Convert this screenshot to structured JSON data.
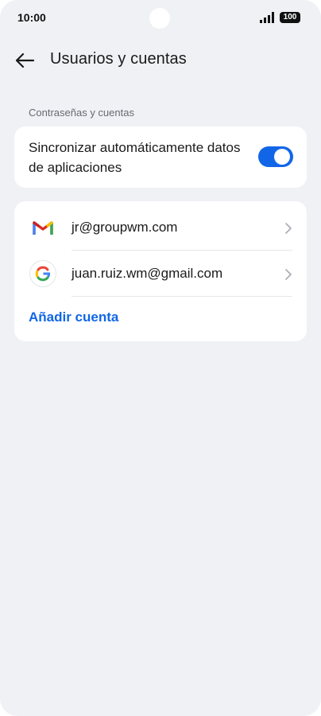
{
  "status_bar": {
    "time": "10:00",
    "battery": "100",
    "icons": [
      "signal-icon",
      "battery-icon"
    ]
  },
  "header": {
    "back_icon": "back-arrow-icon",
    "title": "Usuarios y cuentas"
  },
  "section": {
    "label": "Contraseñas y cuentas"
  },
  "sync": {
    "label": "Sincronizar automáticamente datos de aplicaciones",
    "enabled": true
  },
  "accounts": [
    {
      "icon": "gmail-icon",
      "label": "jr@groupwm.com"
    },
    {
      "icon": "google-icon",
      "label": "juan.ruiz.wm@gmail.com"
    }
  ],
  "add_account": {
    "label": "Añadir cuenta"
  },
  "colors": {
    "accent": "#1166e8",
    "background": "#f0f1f5",
    "card": "#ffffff",
    "text": "#1a1a1a",
    "secondary_text": "#666a70"
  }
}
